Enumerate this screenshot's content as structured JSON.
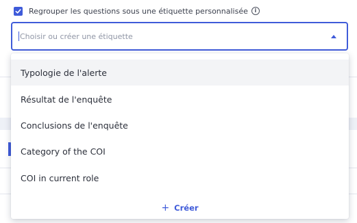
{
  "group_checkbox": {
    "checked": true,
    "label": "Regrouper les questions sous une étiquette personnalisée",
    "info_icon": "info-icon"
  },
  "tag_select": {
    "placeholder": "Choisir ou créer une étiquette",
    "expanded": true,
    "accent_color": "#3f5bd9"
  },
  "dropdown": {
    "options": [
      {
        "label": "Typologie de l'alerte",
        "highlighted": true
      },
      {
        "label": "Résultat de l'enquête",
        "highlighted": false
      },
      {
        "label": "Conclusions de l'enquête",
        "highlighted": false
      },
      {
        "label": "Category of the COI",
        "highlighted": false
      },
      {
        "label": "COI in current role",
        "highlighted": false
      }
    ],
    "create_icon": "+",
    "create_label": "Créer"
  }
}
